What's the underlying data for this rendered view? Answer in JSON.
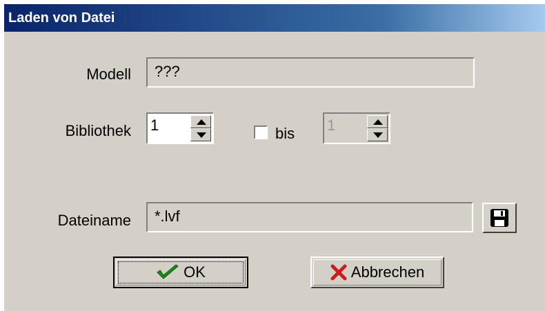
{
  "window": {
    "title": "Laden von Datei"
  },
  "form": {
    "modell": {
      "label": "Modell",
      "value": "???"
    },
    "bibliothek": {
      "label": "Bibliothek",
      "from_value": "1",
      "to_value": "1"
    },
    "bis": {
      "label": "bis",
      "checked": false
    },
    "dateiname": {
      "label": "Dateiname",
      "value": "*.lvf"
    }
  },
  "buttons": {
    "ok_label": "OK",
    "cancel_label": "Abbrechen"
  },
  "icons": {
    "ok": "check-icon",
    "cancel": "x-icon",
    "browse": "floppy-disk-icon"
  },
  "colors": {
    "title_start": "#0a246a",
    "title_end": "#a6caf0",
    "check": "#1a8c1a",
    "cross": "#cc1b1b",
    "face": "#d4d0c8"
  }
}
